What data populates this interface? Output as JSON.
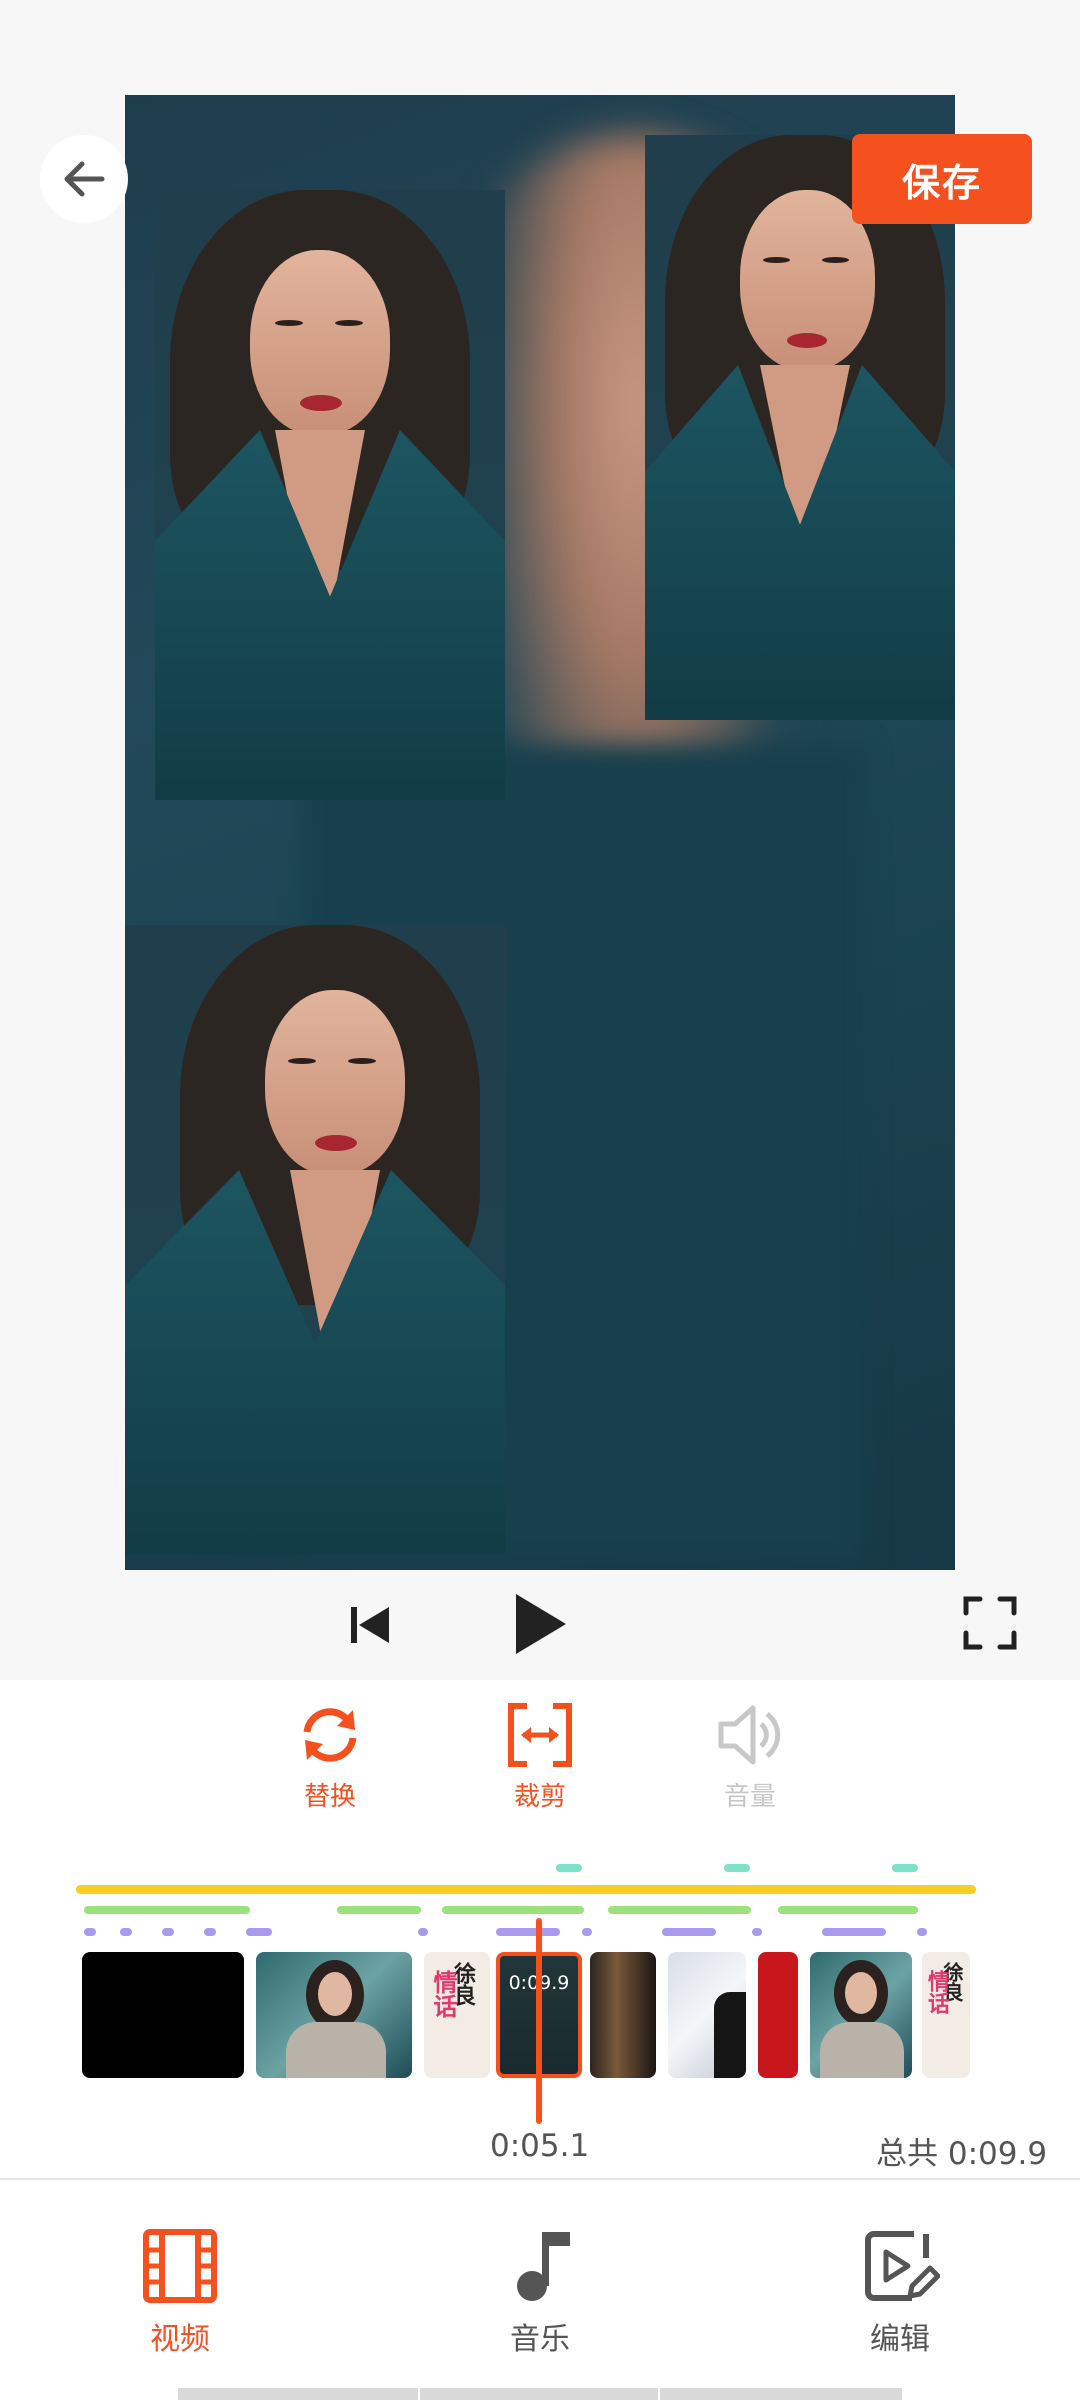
{
  "header": {
    "save_label": "保存"
  },
  "tools": [
    {
      "label": "替换",
      "icon": "replace-icon",
      "color": "#f4511e"
    },
    {
      "label": "裁剪",
      "icon": "crop-icon",
      "color": "#f4511e"
    },
    {
      "label": "音量",
      "icon": "volume-icon",
      "color": "#c8c8c8"
    }
  ],
  "timeline": {
    "thumb_label": "0:09.9",
    "current_time": "0:05.1",
    "total_time": "总共 0:09.9",
    "overlay_text_1": "徐良",
    "overlay_text_2": "情话"
  },
  "bottom_nav": [
    {
      "label": "视频",
      "icon": "video-film-icon",
      "active": true
    },
    {
      "label": "音乐",
      "icon": "music-note-icon",
      "active": false
    },
    {
      "label": "编辑",
      "icon": "edit-video-icon",
      "active": false
    }
  ],
  "colors": {
    "accent": "#f4511e",
    "inactive": "#555555"
  }
}
